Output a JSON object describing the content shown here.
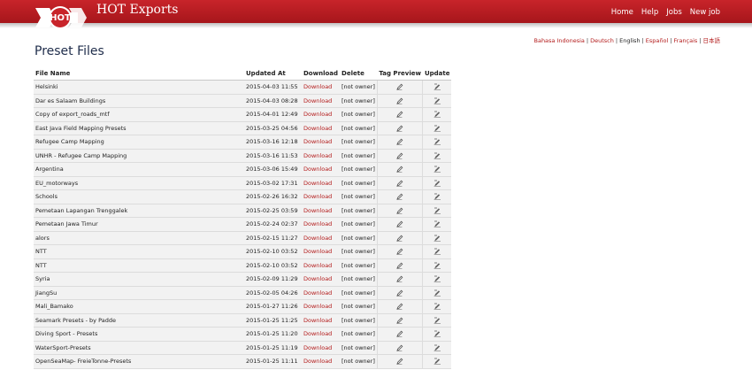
{
  "header": {
    "logo_text": "HOT",
    "app_title": "HOT Exports",
    "brand_color": "#b51c21",
    "nav": [
      {
        "label": "Home"
      },
      {
        "label": "Help"
      },
      {
        "label": "Jobs"
      },
      {
        "label": "New job"
      }
    ]
  },
  "languages": [
    {
      "label": "Bahasa Indonesia",
      "active": false
    },
    {
      "label": "Deutsch",
      "active": false
    },
    {
      "label": "English",
      "active": true
    },
    {
      "label": "Español",
      "active": false
    },
    {
      "label": "Français",
      "active": false
    },
    {
      "label": "日本語",
      "active": false
    }
  ],
  "page_title": "Preset Files",
  "table": {
    "columns": [
      "File Name",
      "Updated At",
      "Download",
      "Delete",
      "Tag Preview",
      "Update"
    ],
    "download_label": "Download",
    "delete_label": "[not owner]",
    "tag_preview_icon": "pencil-icon",
    "update_icon": "edit-icon",
    "rows": [
      {
        "name": "Helsinki",
        "updated": "2015-04-03 11:55"
      },
      {
        "name": "Dar es Salaam Buildings",
        "updated": "2015-04-03 08:28"
      },
      {
        "name": "Copy of export_roads_mtf",
        "updated": "2015-04-01 12:49"
      },
      {
        "name": "East Java Field Mapping Presets",
        "updated": "2015-03-25 04:56"
      },
      {
        "name": "Refugee Camp Mapping",
        "updated": "2015-03-16 12:18"
      },
      {
        "name": "UNHR - Refugee Camp Mapping",
        "updated": "2015-03-16 11:53"
      },
      {
        "name": "Argentina",
        "updated": "2015-03-06 15:49"
      },
      {
        "name": "EU_motorways",
        "updated": "2015-03-02 17:31"
      },
      {
        "name": "Schools",
        "updated": "2015-02-26 16:32"
      },
      {
        "name": "Pemetaan Lapangan Trenggalek",
        "updated": "2015-02-25 03:59"
      },
      {
        "name": "Pemetaan Jawa Timur",
        "updated": "2015-02-24 02:37"
      },
      {
        "name": "alors",
        "updated": "2015-02-15 11:27"
      },
      {
        "name": "NTT",
        "updated": "2015-02-10 03:52"
      },
      {
        "name": "NTT",
        "updated": "2015-02-10 03:52"
      },
      {
        "name": "Syria",
        "updated": "2015-02-09 11:29"
      },
      {
        "name": "JiangSu",
        "updated": "2015-02-05 04:26"
      },
      {
        "name": "Mali_Bamako",
        "updated": "2015-01-27 11:26"
      },
      {
        "name": "Seamark Presets - by Padde",
        "updated": "2015-01-25 11:25"
      },
      {
        "name": "Diving Sport - Presets",
        "updated": "2015-01-25 11:20"
      },
      {
        "name": "WaterSport-Presets",
        "updated": "2015-01-25 11:19"
      },
      {
        "name": "OpenSeaMap- FreieTonne-Presets",
        "updated": "2015-01-25 11:11"
      }
    ]
  }
}
